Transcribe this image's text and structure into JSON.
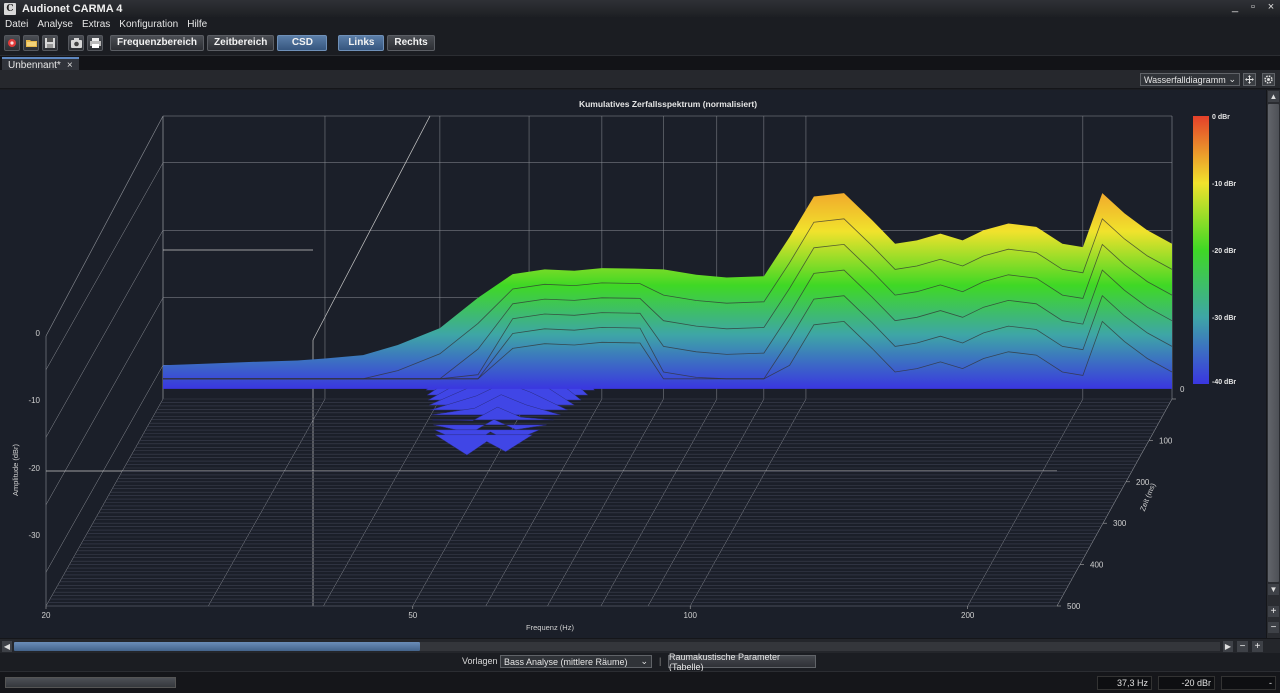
{
  "window": {
    "icon_letter": "C",
    "title": "Audionet CARMA 4",
    "controls": [
      "_",
      "▫",
      "×"
    ]
  },
  "menu": [
    "Datei",
    "Analyse",
    "Extras",
    "Konfiguration",
    "Hilfe"
  ],
  "toolbar": {
    "icons": [
      "record-icon",
      "open-folder-icon",
      "save-icon",
      "screenshot-icon",
      "print-icon"
    ],
    "buttons": {
      "frequency": "Frequenzbereich",
      "time": "Zeitbereich",
      "csd": "CSD",
      "left": "Links",
      "right": "Rechts"
    },
    "active": [
      "csd",
      "left"
    ]
  },
  "document_tab": {
    "label": "Unbennant*",
    "close": "×"
  },
  "view": {
    "selected": "Wasserfalldiagramm",
    "options_arrow": "⌄"
  },
  "chart_data": {
    "type": "waterfall",
    "title": "Kumulatives Zerfallsspektrum (normalisiert)",
    "x_axis": {
      "label": "Frequenz (Hz)",
      "scale": "log",
      "range": [
        20,
        250
      ],
      "ticks": [
        20,
        50,
        100,
        200
      ]
    },
    "y_axis": {
      "label": "Amplitude (dBr)",
      "range": [
        -35,
        5
      ],
      "ticks": [
        0,
        -10,
        -20,
        -30
      ]
    },
    "z_axis": {
      "label": "Zeit (ms)",
      "range": [
        0,
        500
      ],
      "ticks": [
        0,
        100,
        200,
        300,
        400,
        500
      ]
    },
    "colorbar": {
      "labels": [
        "0 dBr",
        "-10 dBr",
        "-20 dBr",
        "-30 dBr",
        "-40 dBr"
      ],
      "colors": [
        "#e4402a",
        "#f1e22c",
        "#3fd825",
        "#3ea6a6",
        "#3a36e0"
      ]
    },
    "front_slice": {
      "time_ms": 0,
      "frequency_hz": [
        20,
        22,
        25,
        28,
        30,
        33,
        36,
        40,
        44,
        48,
        52,
        56,
        60,
        66,
        70,
        76,
        82,
        90,
        96,
        102,
        110,
        118,
        125,
        132,
        140,
        148,
        156,
        166,
        178,
        190,
        200,
        210,
        222,
        235,
        250
      ],
      "level_dbr": [
        -30,
        -29.8,
        -29.5,
        -29.3,
        -29,
        -28.5,
        -27,
        -24.5,
        -20,
        -16.5,
        -15.8,
        -16,
        -15.6,
        -15.7,
        -15.8,
        -16.6,
        -17,
        -16.8,
        -11,
        -5,
        -4.5,
        -8.5,
        -12,
        -11.5,
        -10.5,
        -11.5,
        -10,
        -9,
        -9.5,
        -12,
        -12.5,
        -4.5,
        -7.5,
        -10,
        -12
      ]
    },
    "grid": true
  },
  "templates": {
    "label": "Vorlagen",
    "selected": "Bass Analyse (mittlere Räume)",
    "separator": "|",
    "room_button": "Raumakustische Parameter (Tabelle)"
  },
  "status": {
    "frequency": "37,3 Hz",
    "amplitude": "-20 dBr",
    "extra": "-"
  }
}
